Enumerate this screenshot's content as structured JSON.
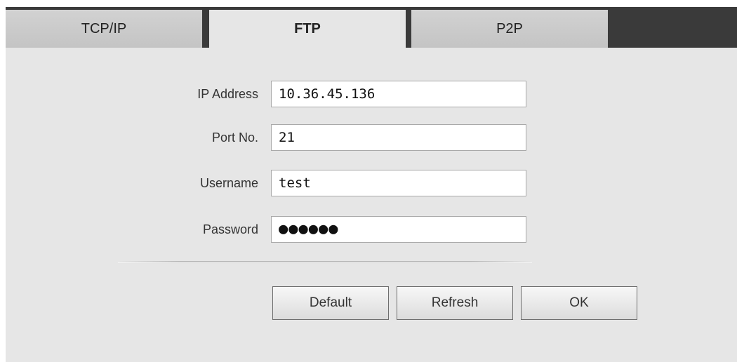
{
  "tabs": [
    {
      "label": "TCP/IP",
      "active": false
    },
    {
      "label": "FTP",
      "active": true
    },
    {
      "label": "P2P",
      "active": false
    }
  ],
  "form": {
    "ip_address": {
      "label": "IP Address",
      "value": "10.36.45.136"
    },
    "port": {
      "label": "Port No.",
      "value": "21"
    },
    "username": {
      "label": "Username",
      "value": "test"
    },
    "password": {
      "label": "Password",
      "value": "●●●●●●"
    }
  },
  "buttons": {
    "default": "Default",
    "refresh": "Refresh",
    "ok": "OK"
  },
  "colors": {
    "tabbar_background": "#3a3a3a",
    "panel_background": "#e6e6e6",
    "inactive_tab": "#c8c8c8"
  }
}
